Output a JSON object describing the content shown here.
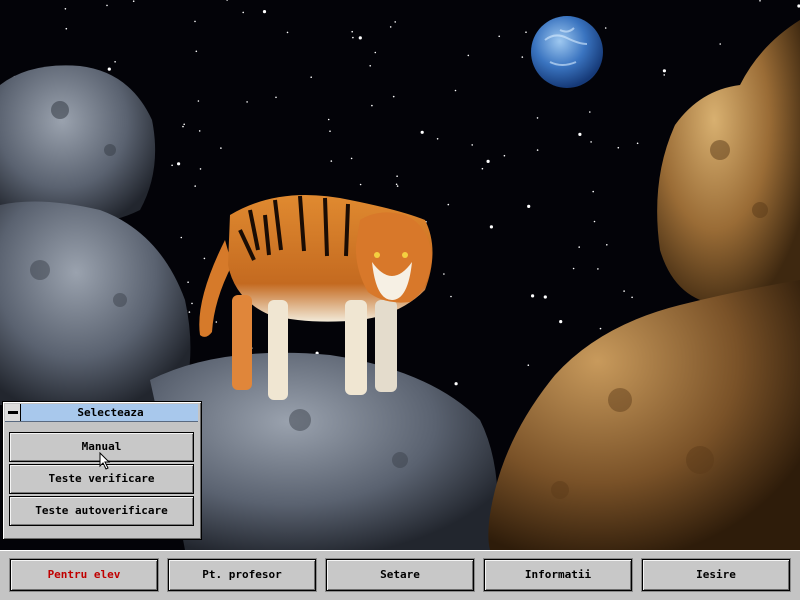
{
  "menu": {
    "title": "Selecteaza",
    "items": [
      {
        "label": "Manual"
      },
      {
        "label": "Teste verificare"
      },
      {
        "label": "Teste autoverificare"
      }
    ]
  },
  "toolbar": {
    "buttons": [
      {
        "label": "Pentru elev",
        "active": true
      },
      {
        "label": "Pt. profesor"
      },
      {
        "label": "Setare"
      },
      {
        "label": "Informatii"
      },
      {
        "label": "Iesire"
      }
    ]
  },
  "colors": {
    "titlebar": "#a8c8ec",
    "panel": "#c4c4c4",
    "active_label": "#c00000"
  },
  "icons": {
    "system_menu": "minus-icon",
    "cursor": "arrow-cursor-icon"
  }
}
